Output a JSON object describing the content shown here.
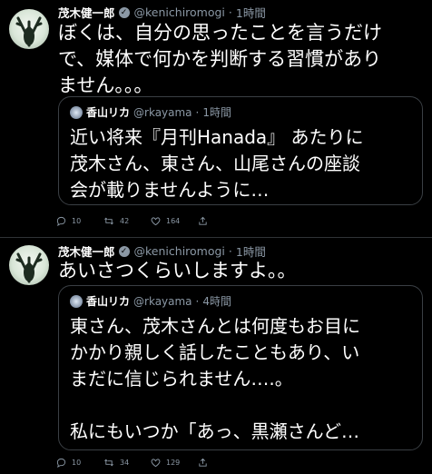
{
  "tweets": [
    {
      "author": {
        "name": "茂木健一郎",
        "handle": "@kenichiromogi",
        "time": "1時間"
      },
      "text_lines": [
        "ぼくは、自分の思ったことを言うだけ",
        "で、媒体で何かを判断する習慣があり",
        "ません。。。"
      ],
      "quote": {
        "author": {
          "name": "香山リカ",
          "handle": "@rkayama",
          "time": "1時間"
        },
        "text_lines": [
          "近い将来『月刊Hanada』 あたりに",
          "茂木さん、東さん、山尾さんの座談",
          "会が載りませんように…"
        ]
      },
      "stats": {
        "replies": "10",
        "retweets": "42",
        "likes": "164"
      }
    },
    {
      "author": {
        "name": "茂木健一郎",
        "handle": "@kenichiromogi",
        "time": "1時間"
      },
      "text_lines": [
        "あいさつくらいしますよ。。"
      ],
      "quote": {
        "author": {
          "name": "香山リカ",
          "handle": "@rkayama",
          "time": "4時間"
        },
        "text_lines": [
          "東さん、茂木さんとは何度もお目に",
          "かかり親しく話したこともあり、い",
          "まだに信じられません….。",
          "",
          "私にもいつか「あっ、黒瀬さんど…"
        ]
      },
      "stats": {
        "replies": "10",
        "retweets": "34",
        "likes": "129"
      }
    }
  ],
  "icons": {
    "verified": "verified-icon",
    "reply": "reply-icon",
    "retweet": "retweet-icon",
    "like": "heart-icon",
    "share": "share-icon"
  },
  "colors": {
    "background": "#000000",
    "text": "#ffffff",
    "muted": "#8b98a5",
    "border": "#3a3f44"
  }
}
